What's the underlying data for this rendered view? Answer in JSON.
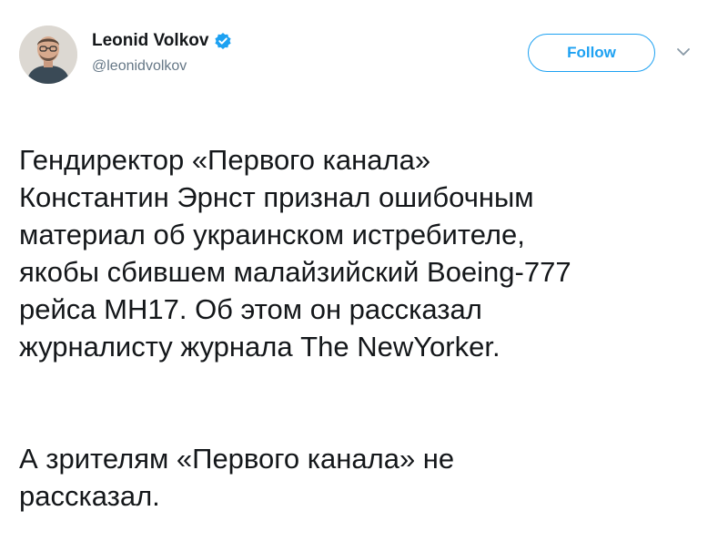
{
  "author": {
    "name": "Leonid Volkov",
    "handle": "@leonidvolkov",
    "verified": true
  },
  "actions": {
    "follow_label": "Follow",
    "menu_icon": "chevron-down-icon"
  },
  "tweet": {
    "paragraph1": "Гендиректор «Первого канала»\nКонстантин Эрнст признал ошибочным\nматериал об украинском истребителе,\nякобы сбившем малайзийский Boeing-777\nрейса MH17. Об этом он рассказал\nжурналисту журнала The NewYorker.",
    "paragraph2": "А зрителям «Первого канала» не\nрассказал."
  },
  "colors": {
    "accent": "#1da1f2",
    "text": "#14171a",
    "secondary": "#657786"
  }
}
